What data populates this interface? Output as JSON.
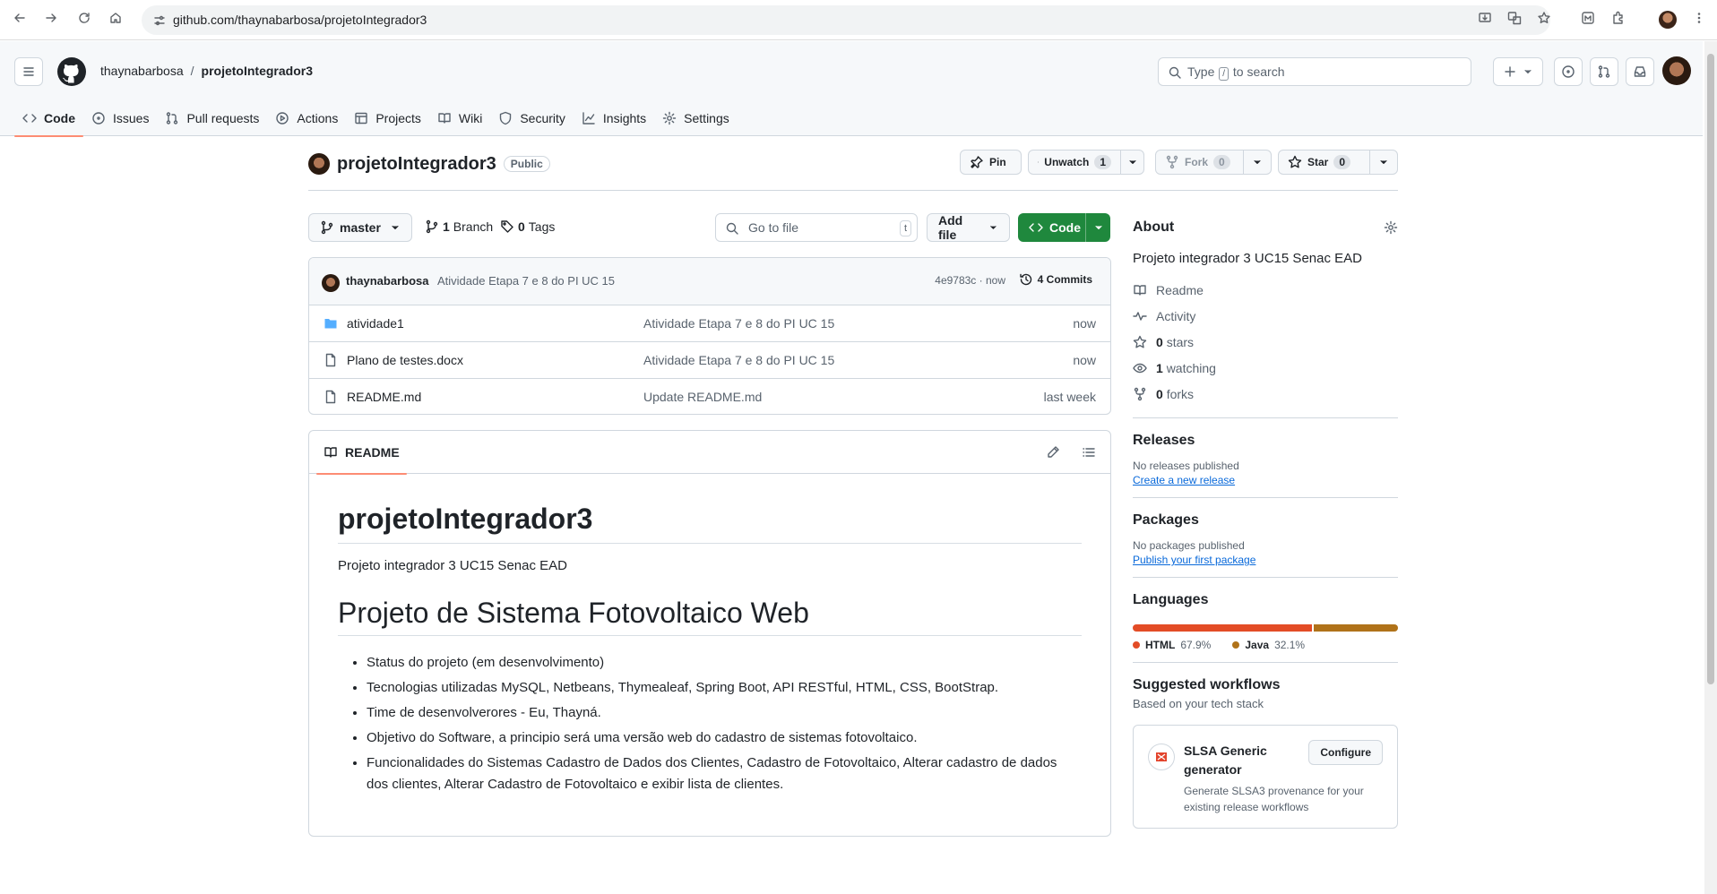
{
  "browser": {
    "url": "github.com/thaynabarbosa/projetoIntegrador3"
  },
  "header": {
    "owner": "thaynabarbosa",
    "separator": "/",
    "repo": "projetoIntegrador3",
    "search_prefix": "Type",
    "search_key": "/",
    "search_suffix": "to search"
  },
  "tabs": [
    {
      "label": "Code",
      "icon": "code-icon"
    },
    {
      "label": "Issues",
      "icon": "issue-icon"
    },
    {
      "label": "Pull requests",
      "icon": "pull-request-icon"
    },
    {
      "label": "Actions",
      "icon": "play-icon"
    },
    {
      "label": "Projects",
      "icon": "table-icon"
    },
    {
      "label": "Wiki",
      "icon": "book-icon"
    },
    {
      "label": "Security",
      "icon": "shield-icon"
    },
    {
      "label": "Insights",
      "icon": "graph-icon"
    },
    {
      "label": "Settings",
      "icon": "gear-icon"
    }
  ],
  "repo": {
    "name": "projetoIntegrador3",
    "visibility": "Public",
    "pin_label": "Pin",
    "watch_label": "Unwatch",
    "watch_count": "1",
    "fork_label": "Fork",
    "fork_count": "0",
    "star_label": "Star",
    "star_count": "0"
  },
  "filenav": {
    "branch": "master",
    "branches_count": "1",
    "branches_label": "Branch",
    "tags_count": "0",
    "tags_label": "Tags",
    "goto_placeholder": "Go to file",
    "goto_key": "t",
    "add_file": "Add file",
    "code_label": "Code"
  },
  "commit": {
    "author": "thaynabarbosa",
    "message": "Atividade Etapa 7 e 8 do PI UC 15",
    "sha_time": "4e9783c · now",
    "commits_label": "4 Commits"
  },
  "files": [
    {
      "type": "folder",
      "name": "atividade1",
      "message": "Atividade Etapa 7 e 8 do PI UC 15",
      "time": "now"
    },
    {
      "type": "file",
      "name": "Plano de testes.docx",
      "message": "Atividade Etapa 7 e 8 do PI UC 15",
      "time": "now"
    },
    {
      "type": "file",
      "name": "README.md",
      "message": "Update README.md",
      "time": "last week"
    }
  ],
  "readme": {
    "tab_label": "README",
    "h1": "projetoIntegrador3",
    "intro": "Projeto integrador 3 UC15 Senac EAD",
    "h2": "Projeto de Sistema Fotovoltaico Web",
    "items": [
      "Status do projeto (em desenvolvimento)",
      "Tecnologias utilizadas MySQL, Netbeans, Thymealeaf, Spring Boot, API RESTful, HTML, CSS, BootStrap.",
      "Time de desenvolverores - Eu, Thayná.",
      "Objetivo do Software, a principio será uma versão web do cadastro de sistemas fotovoltaico.",
      "Funcionalidades do Sistemas Cadastro de Dados dos Clientes, Cadastro de Fotovoltaico, Alterar cadastro de dados dos clientes, Alterar Cadastro de Fotovoltaico e exibir lista de clientes."
    ]
  },
  "about": {
    "title": "About",
    "description": "Projeto integrador 3 UC15 Senac EAD",
    "readme": "Readme",
    "activity": "Activity",
    "stars_count": "0",
    "stars_label": "stars",
    "watching_count": "1",
    "watching_label": "watching",
    "forks_count": "0",
    "forks_label": "forks"
  },
  "releases": {
    "title": "Releases",
    "empty": "No releases published",
    "link": "Create a new release"
  },
  "packages": {
    "title": "Packages",
    "empty": "No packages published",
    "link": "Publish your first package"
  },
  "languages": {
    "title": "Languages",
    "items": [
      {
        "name": "HTML",
        "percent": "67.9%",
        "value": 67.9,
        "color": "#e34c26"
      },
      {
        "name": "Java",
        "percent": "32.1%",
        "value": 32.1,
        "color": "#b07219"
      }
    ]
  },
  "workflows": {
    "title": "Suggested workflows",
    "subtitle": "Based on your tech stack",
    "card_title": "SLSA Generic generator",
    "card_desc": "Generate SLSA3 provenance for your existing release workflows",
    "configure": "Configure"
  },
  "colors": {
    "code_button": "#1f883d",
    "tab_underline": "#fd8c73",
    "link": "#0969da"
  }
}
